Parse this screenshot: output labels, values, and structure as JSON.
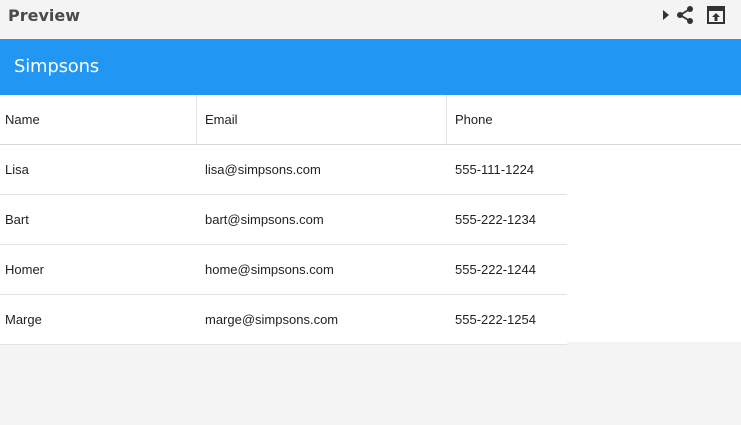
{
  "preview": {
    "title": "Preview",
    "icons": [
      "play-arrow-icon",
      "share-icon",
      "open-external-icon"
    ]
  },
  "app": {
    "title": "Simpsons",
    "header_color": "#2196f3"
  },
  "table": {
    "columns": [
      "Name",
      "Email",
      "Phone"
    ],
    "rows": [
      {
        "name": "Lisa",
        "email": "lisa@simpsons.com",
        "phone": "555-111-1224"
      },
      {
        "name": "Bart",
        "email": "bart@simpsons.com",
        "phone": "555-222-1234"
      },
      {
        "name": "Homer",
        "email": "home@simpsons.com",
        "phone": "555-222-1244"
      },
      {
        "name": "Marge",
        "email": "marge@simpsons.com",
        "phone": "555-222-1254"
      }
    ]
  }
}
